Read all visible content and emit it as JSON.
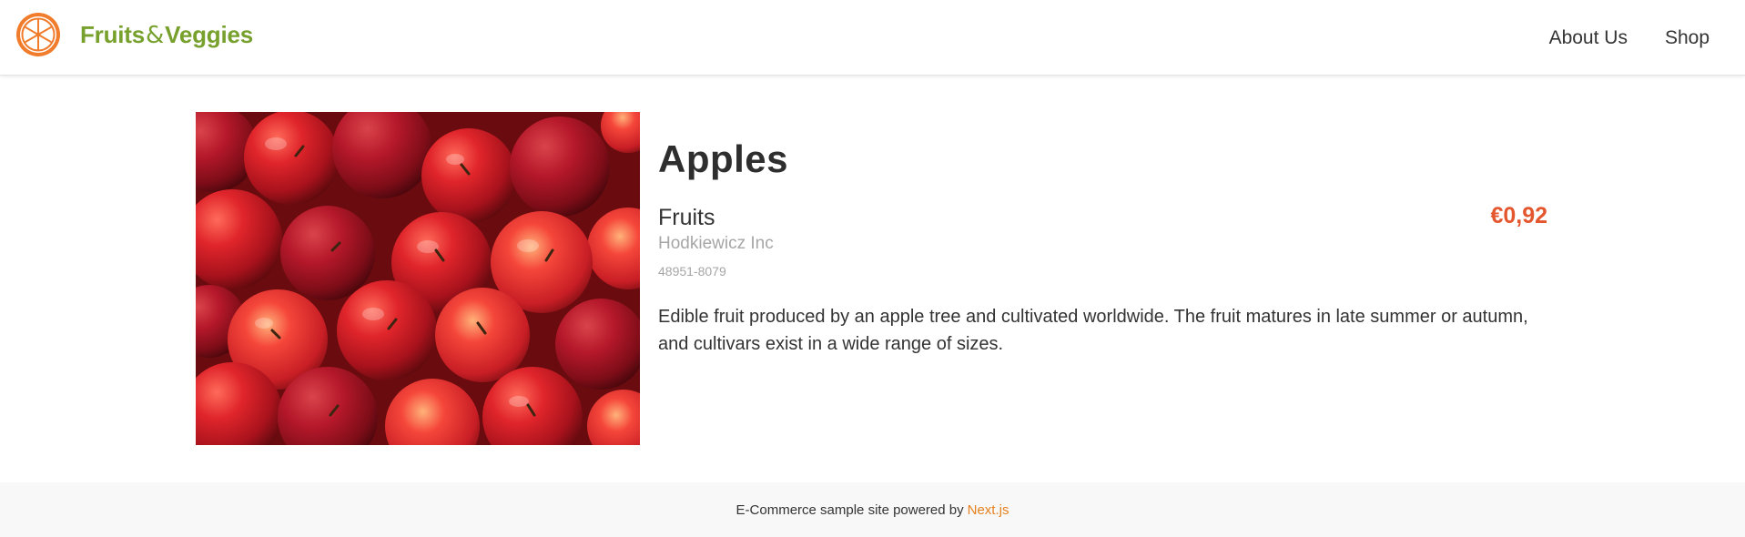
{
  "header": {
    "brand_word_1": "Fruits",
    "brand_amp": "&",
    "brand_word_2": "Veggies",
    "logo_icon": "orange-slice-icon",
    "nav": [
      {
        "label": "About Us"
      },
      {
        "label": "Shop"
      }
    ]
  },
  "product": {
    "image_alt": "Apples",
    "title": "Apples",
    "category": "Fruits",
    "vendor": "Hodkiewicz Inc",
    "sku": "48951-8079",
    "price": "€0,92",
    "description": "Edible fruit produced by an apple tree and cultivated worldwide. The fruit matures in late summer or autumn, and cultivars exist in a wide range of sizes."
  },
  "footer": {
    "text": "E-Commerce sample site powered by",
    "link_label": "Next.js"
  },
  "colors": {
    "brand_green": "#77a02d",
    "logo_orange": "#f07c2c",
    "price_red": "#e4572e",
    "link_orange": "#e4801d",
    "footer_bg": "#f8f8f8"
  }
}
